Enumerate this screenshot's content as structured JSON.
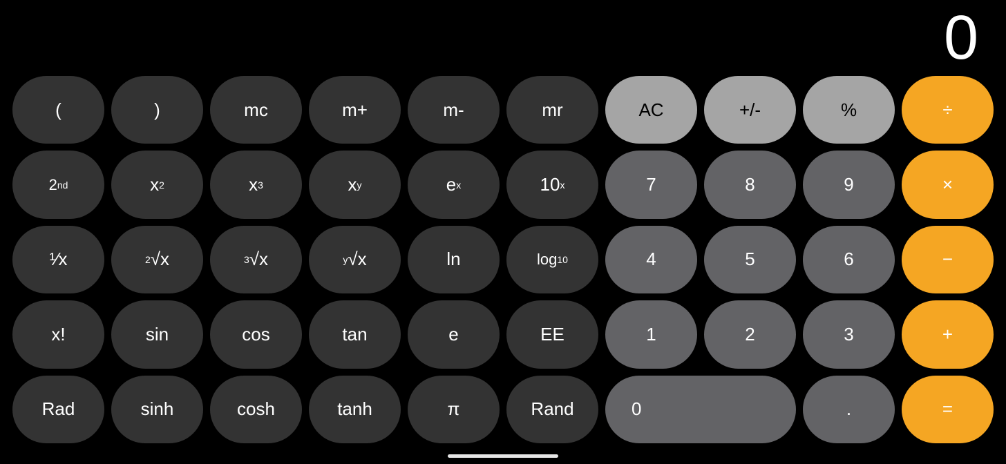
{
  "display": {
    "value": "0"
  },
  "buttons": {
    "row1": [
      {
        "id": "open-paren",
        "label": "(",
        "type": "dark"
      },
      {
        "id": "close-paren",
        "label": ")",
        "type": "dark"
      },
      {
        "id": "mc",
        "label": "mc",
        "type": "dark"
      },
      {
        "id": "m-plus",
        "label": "m+",
        "type": "dark"
      },
      {
        "id": "m-minus",
        "label": "m-",
        "type": "dark"
      },
      {
        "id": "mr",
        "label": "mr",
        "type": "dark"
      },
      {
        "id": "ac",
        "label": "AC",
        "type": "light"
      },
      {
        "id": "plus-minus",
        "label": "+/-",
        "type": "light"
      },
      {
        "id": "percent",
        "label": "%",
        "type": "light"
      },
      {
        "id": "divide",
        "label": "÷",
        "type": "orange"
      }
    ],
    "row2": [
      {
        "id": "2nd",
        "label": "2nd",
        "type": "dark"
      },
      {
        "id": "x2",
        "label": "x²",
        "type": "dark"
      },
      {
        "id": "x3",
        "label": "x³",
        "type": "dark"
      },
      {
        "id": "xy",
        "label": "xy",
        "type": "dark"
      },
      {
        "id": "ex",
        "label": "ex",
        "type": "dark"
      },
      {
        "id": "10x",
        "label": "10x",
        "type": "dark"
      },
      {
        "id": "7",
        "label": "7",
        "type": "medium"
      },
      {
        "id": "8",
        "label": "8",
        "type": "medium"
      },
      {
        "id": "9",
        "label": "9",
        "type": "medium"
      },
      {
        "id": "multiply",
        "label": "×",
        "type": "orange"
      }
    ],
    "row3": [
      {
        "id": "inv-x",
        "label": "¹⁄x",
        "type": "dark"
      },
      {
        "id": "2sqrt-x",
        "label": "²√x",
        "type": "dark"
      },
      {
        "id": "3sqrt-x",
        "label": "³√x",
        "type": "dark"
      },
      {
        "id": "y-sqrt-x",
        "label": "ʸ√x",
        "type": "dark"
      },
      {
        "id": "ln",
        "label": "ln",
        "type": "dark"
      },
      {
        "id": "log10",
        "label": "log₁₀",
        "type": "dark"
      },
      {
        "id": "4",
        "label": "4",
        "type": "medium"
      },
      {
        "id": "5",
        "label": "5",
        "type": "medium"
      },
      {
        "id": "6",
        "label": "6",
        "type": "medium"
      },
      {
        "id": "subtract",
        "label": "−",
        "type": "orange"
      }
    ],
    "row4": [
      {
        "id": "factorial",
        "label": "x!",
        "type": "dark"
      },
      {
        "id": "sin",
        "label": "sin",
        "type": "dark"
      },
      {
        "id": "cos",
        "label": "cos",
        "type": "dark"
      },
      {
        "id": "tan",
        "label": "tan",
        "type": "dark"
      },
      {
        "id": "e",
        "label": "e",
        "type": "dark"
      },
      {
        "id": "ee",
        "label": "EE",
        "type": "dark"
      },
      {
        "id": "1",
        "label": "1",
        "type": "medium"
      },
      {
        "id": "2",
        "label": "2",
        "type": "medium"
      },
      {
        "id": "3",
        "label": "3",
        "type": "medium"
      },
      {
        "id": "add",
        "label": "+",
        "type": "orange"
      }
    ],
    "row5": [
      {
        "id": "rad",
        "label": "Rad",
        "type": "dark"
      },
      {
        "id": "sinh",
        "label": "sinh",
        "type": "dark"
      },
      {
        "id": "cosh",
        "label": "cosh",
        "type": "dark"
      },
      {
        "id": "tanh",
        "label": "tanh",
        "type": "dark"
      },
      {
        "id": "pi",
        "label": "π",
        "type": "dark"
      },
      {
        "id": "rand",
        "label": "Rand",
        "type": "dark"
      },
      {
        "id": "0",
        "label": "0",
        "type": "medium",
        "zero": true
      },
      {
        "id": "decimal",
        "label": ".",
        "type": "medium"
      },
      {
        "id": "equals",
        "label": "=",
        "type": "orange"
      }
    ]
  }
}
